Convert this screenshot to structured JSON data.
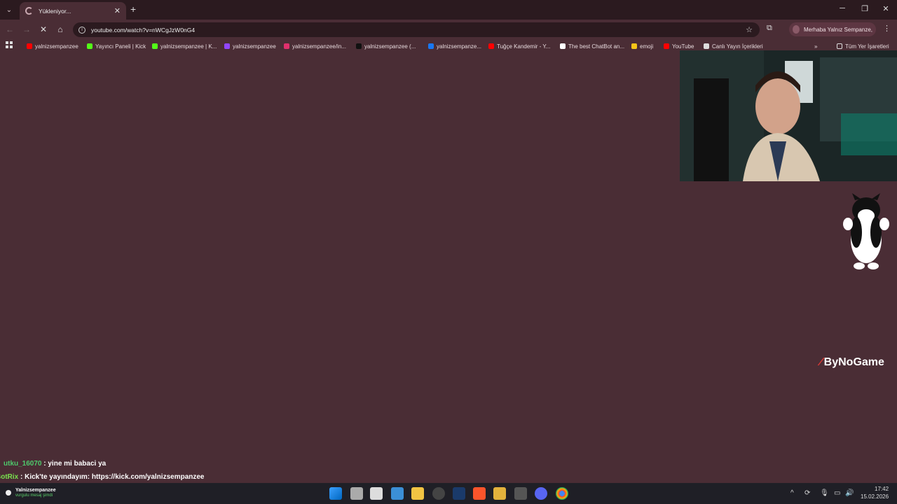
{
  "browser": {
    "tab_title": "Yükleniyor...",
    "url": "youtube.com/watch?v=nWCgJzW0nG4",
    "profile_text": "Merhaba Yalnız Sempanze,",
    "bookmarks": [
      {
        "label": "yalnizsempanzee",
        "icon": "youtube-icon",
        "color": "#ff0000"
      },
      {
        "label": "Yayıncı Paneli | Kick",
        "icon": "kick-icon",
        "color": "#53fc18"
      },
      {
        "label": "yalnizsempanzee | K...",
        "icon": "kick-icon",
        "color": "#53fc18"
      },
      {
        "label": "yalnizsempanzee",
        "icon": "twitch-icon",
        "color": "#9146ff"
      },
      {
        "label": "yalnizsempanzee/in...",
        "icon": "instagram-icon",
        "color": "#e1306c"
      },
      {
        "label": "yalnizsempanzee (...",
        "icon": "tiktok-icon",
        "color": "#111111"
      },
      {
        "label": "yalnizsempanze...",
        "icon": "facebook-icon",
        "color": "#1877f2"
      },
      {
        "label": "Tuğçe Kandemir - Y...",
        "icon": "youtube-icon",
        "color": "#ff0000"
      },
      {
        "label": "The best ChatBot an...",
        "icon": "chatbot-icon",
        "color": "#ffffff"
      },
      {
        "label": "emoji",
        "icon": "emoji-icon",
        "color": "#f5c518"
      },
      {
        "label": "YouTube",
        "icon": "youtube-icon",
        "color": "#ff0000"
      },
      {
        "label": "Canlı Yayın İçerikleri",
        "icon": "folder-icon",
        "color": "#dddddd"
      }
    ],
    "all_bookmarks_label": "Tüm Yer İşaretleri"
  },
  "overlay": {
    "brand": "ByNoGame",
    "chat": [
      {
        "user": "utku_16070",
        "message": " : yine mi babaci ya"
      },
      {
        "user": "BotRix",
        "message": " : Kick'te yayındayım: https://kick.com/yalnizsempanzee"
      }
    ]
  },
  "taskbar": {
    "weather_title": "Yalnizsempanzee",
    "weather_sub": "vurgulu mesaj şimdi",
    "time": "17:42",
    "date": "15.02.2026"
  },
  "colors": {
    "page_bg": "#4a2d35",
    "titlebar_bg": "#2b1a1f",
    "taskbar_bg": "#1f1f26"
  }
}
